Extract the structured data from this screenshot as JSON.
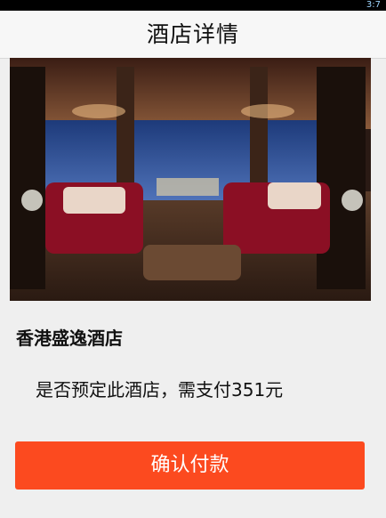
{
  "title_bar": {
    "title": "酒店详情"
  },
  "status_bar": {
    "clock_partial": "3:7"
  },
  "hotel": {
    "name": "香港盛逸酒店",
    "prompt": "是否预定此酒店，需支付351元"
  },
  "actions": {
    "confirm_payment_label": "确认付款"
  },
  "colors": {
    "accent": "#fc4a1f",
    "title_bar_bg": "#f7f7f7",
    "page_bg": "#efefef"
  }
}
